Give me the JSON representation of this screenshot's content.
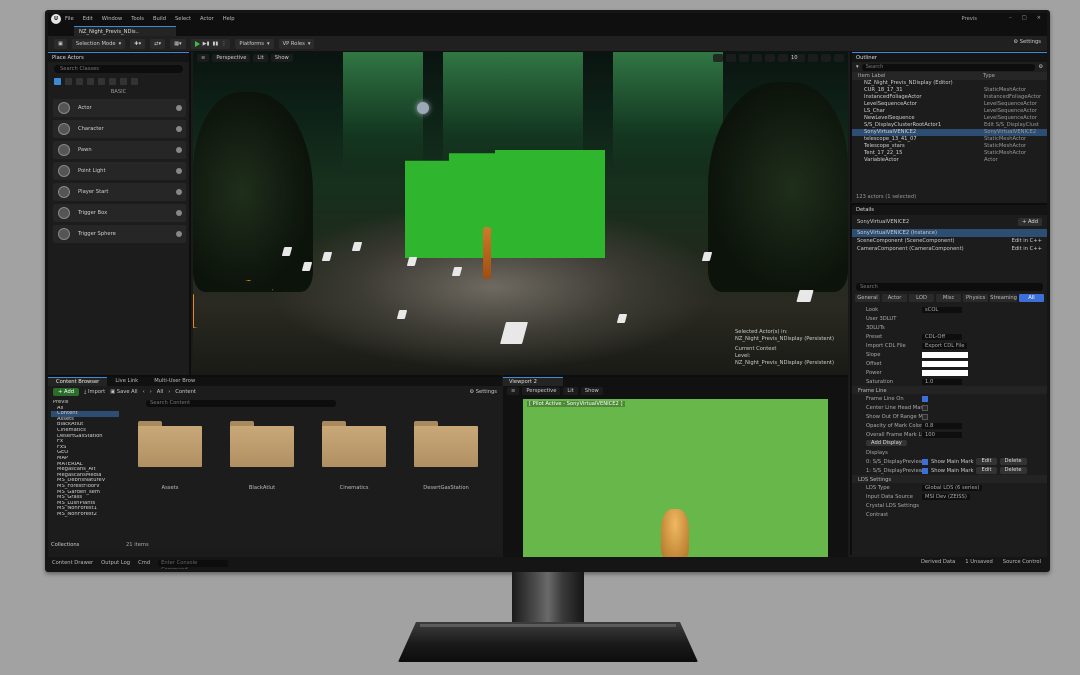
{
  "menubar": {
    "logo": "U",
    "items": [
      "File",
      "Edit",
      "Window",
      "Tools",
      "Build",
      "Select",
      "Actor",
      "Help"
    ],
    "project_name": "Previs"
  },
  "tab": {
    "map_name": "NZ_Night_Previs_NDis.."
  },
  "toolbar": {
    "selection_mode": "Selection Mode",
    "platforms": "Platforms",
    "vp_roles": "VP Roles",
    "settings": "Settings"
  },
  "place_actors": {
    "title": "Place Actors",
    "search_placeholder": "Search Classes",
    "category": "BASIC",
    "items": [
      {
        "label": "Actor"
      },
      {
        "label": "Character"
      },
      {
        "label": "Pawn"
      },
      {
        "label": "Point Light"
      },
      {
        "label": "Player Start"
      },
      {
        "label": "Trigger Box"
      },
      {
        "label": "Trigger Sphere"
      }
    ]
  },
  "viewport": {
    "perspective": "Perspective",
    "lit": "Lit",
    "show": "Show",
    "overlay_actors": "Selected Actor(s) in:",
    "overlay_level_path": "NZ_Night_Previs_NDisplay (Persistent)",
    "current_context": "Current Context",
    "level_label": "Level:",
    "level_value": "NZ_Night_Previs_NDisplay (Persistent)",
    "snap_value": "10"
  },
  "outliner": {
    "title": "Outliner",
    "search_placeholder": "Search",
    "col_label": "Item Label",
    "col_type": "Type",
    "rows": [
      {
        "label": "NZ_Night_Previs_NDisplay (Editor)",
        "type": "",
        "selected": false
      },
      {
        "label": "CUR_18_17_31",
        "type": "StaticMeshActor",
        "selected": false
      },
      {
        "label": "InstancedFoliageActor",
        "type": "InstancedFoliageActor",
        "selected": false
      },
      {
        "label": "LevelSequenceActor",
        "type": "LevelSequenceActor",
        "selected": false
      },
      {
        "label": "LS_Char",
        "type": "LevelSequenceActor",
        "selected": false
      },
      {
        "label": "NewLevelSequence",
        "type": "LevelSequenceActor",
        "selected": false
      },
      {
        "label": "S/S_DisplayClusterRootActor1",
        "type": "Edit S/S_DisplayClust",
        "selected": false
      },
      {
        "label": "SonyVirtualVENICE2",
        "type": "SonyVirtualVENICE2",
        "selected": true
      },
      {
        "label": "telescope_13_41_07",
        "type": "StaticMeshActor",
        "selected": false
      },
      {
        "label": "Telescope_stars",
        "type": "StaticMeshActor",
        "selected": false
      },
      {
        "label": "Tent_17_22_15",
        "type": "StaticMeshActor",
        "selected": false
      },
      {
        "label": "VariableActor",
        "type": "Actor",
        "selected": false
      }
    ],
    "footer": "123 actors (1 selected)"
  },
  "details": {
    "title": "Details",
    "actor_name": "SonyVirtualVENICE2",
    "add_label": "Add",
    "components": [
      {
        "label": "SonyVirtualVENICE2 (Instance)",
        "edit": "",
        "selected": true
      },
      {
        "label": "SceneComponent (SceneComponent)",
        "edit": "Edit in C++",
        "selected": false
      },
      {
        "label": "CameraComponent (CameraComponent)",
        "edit": "Edit in C++",
        "selected": false
      }
    ],
    "search_placeholder": "Search",
    "tabs": [
      "General",
      "Actor",
      "LOD",
      "Misc",
      "Physics",
      "Streaming",
      "All"
    ],
    "props": [
      {
        "k": "Look",
        "v": "sCOL"
      },
      {
        "k": "User 3DLUT",
        "v": ""
      },
      {
        "k": "3DLUTs",
        "v": ""
      },
      {
        "k": "Preset",
        "v": "CDL-Off"
      },
      {
        "k": "Import CDL File",
        "v": "Export CDL File"
      },
      {
        "k": "Slope",
        "v": ""
      },
      {
        "k": "Offset",
        "v": ""
      },
      {
        "k": "Power",
        "v": ""
      },
      {
        "k": "Saturation",
        "v": "1.0"
      }
    ],
    "section_frameline": "Frame Line",
    "frame_props": [
      {
        "k": "Frame Line On",
        "v": ""
      },
      {
        "k": "Center Line Head Mark",
        "v": ""
      },
      {
        "k": "Show Out Of Range Mark",
        "v": ""
      },
      {
        "k": "Opacity of Mark Color",
        "v": "0.8"
      },
      {
        "k": "Overall Frame Mark Lines",
        "v": "100"
      }
    ],
    "add_display": "Add Display",
    "displays_label": "Displays",
    "display_rows": [
      {
        "name": "0: S/S_DisplayPreviewMonit",
        "check": "Show Main Mark",
        "edit": "Edit",
        "del": "Delete"
      },
      {
        "name": "1: S/S_DisplayPreviewMonit",
        "check": "Show Main Mark",
        "edit": "Edit",
        "del": "Delete"
      }
    ],
    "section_lens": "LDS Settings",
    "lens_props": [
      {
        "k": "LDS Type",
        "v": "Global LDS (6 series)"
      },
      {
        "k": "Input Data Source",
        "v": "MSI Dev (ZEISS)"
      },
      {
        "k": "Crystal LDS Settings",
        "v": ""
      },
      {
        "k": "Contrast",
        "v": ""
      }
    ]
  },
  "content_browser": {
    "tabs": [
      "Content Browser",
      "Live Link",
      "Multi-User Brow"
    ],
    "add_label": "Add",
    "import_label": "Import",
    "save_all_label": "Save All",
    "path_all": "All",
    "path_content": "Content",
    "settings_label": "Settings",
    "tree_root": "Previs",
    "tree": [
      "All",
      "Content",
      "Assets",
      "BlackAtlut",
      "Cinematics",
      "DesertGasStation",
      "Fx",
      "FxS",
      "GEO",
      "MAP",
      "MATERIAL",
      "Megascans_Alt",
      "MegascansMedia",
      "MS_DebrisNatureV",
      "MS_ForestFloorV",
      "MS_Garden_sem",
      "MS_Grass",
      "MS_LushPlants",
      "MS_NonForest1",
      "MS_NonForest2"
    ],
    "search_placeholder": "Search Content",
    "folders": [
      "Assets",
      "BlackAtlut",
      "Cinematics",
      "DesertGasStation"
    ],
    "items_count": "21 items",
    "collections": "Collections"
  },
  "viewport2": {
    "tab": "Viewport 2",
    "perspective": "Perspective",
    "lit": "Lit",
    "show": "Show",
    "pilot_label": "[ Pilot Active - SonyVirtualVENICE2 ]"
  },
  "bottombar": {
    "content_drawer": "Content Drawer",
    "output_log": "Output Log",
    "cmd": "Cmd",
    "cmd_placeholder": "Enter Console Command",
    "derived_data": "Derived Data",
    "unsaved": "1 Unsaved",
    "source_control": "Source Control"
  },
  "colors": {
    "accent": "#3d8bd8",
    "selection": "#2e4d72",
    "green_screen": "#2fb52e"
  }
}
